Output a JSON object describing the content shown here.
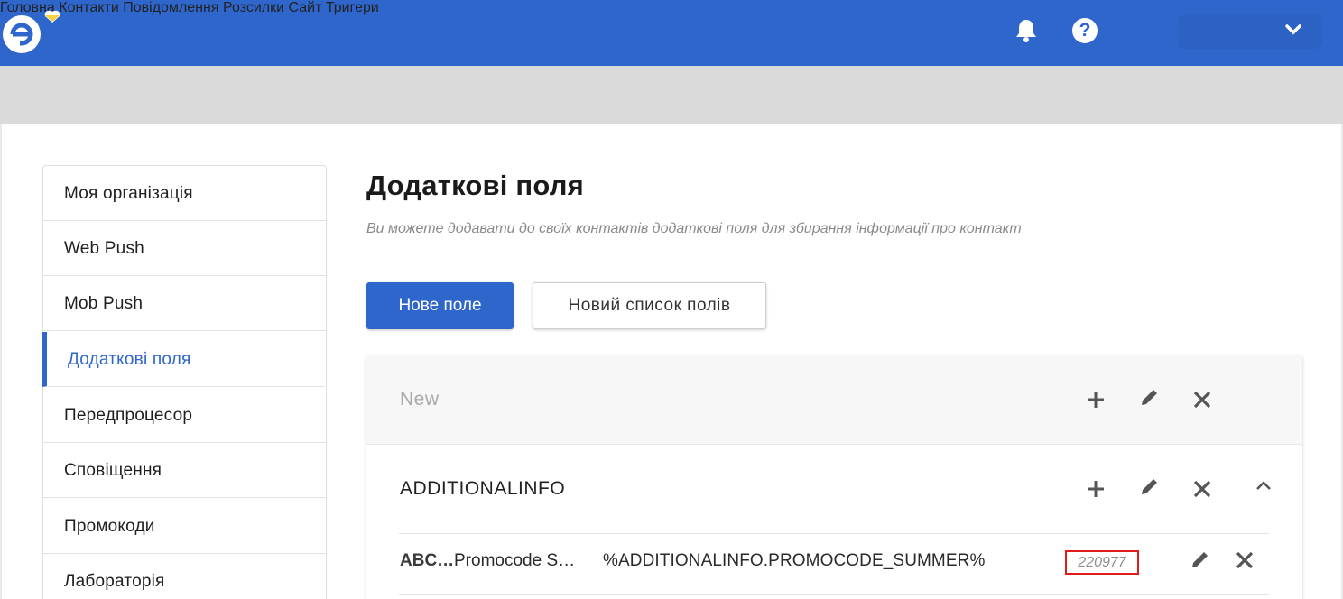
{
  "nav": {
    "items": [
      "Головна",
      "Контакти",
      "Повідомлення",
      "Розсилки",
      "Сайт",
      "Тригери"
    ]
  },
  "sidebar": {
    "items": [
      {
        "label": "Моя організація",
        "active": false
      },
      {
        "label": "Web Push",
        "active": false
      },
      {
        "label": "Mob Push",
        "active": false
      },
      {
        "label": "Додаткові поля",
        "active": true
      },
      {
        "label": "Передпроцесор",
        "active": false
      },
      {
        "label": "Сповіщення",
        "active": false
      },
      {
        "label": "Промокоди",
        "active": false
      },
      {
        "label": "Лабораторія",
        "active": false
      }
    ]
  },
  "main": {
    "title": "Додаткові поля",
    "subtitle": "Ви можете додавати до своїх контактів додаткові поля для збирання інформації про контакт",
    "new_field_button": "Нове поле",
    "new_list_button": "Новий список полів"
  },
  "lists": [
    {
      "name": "New",
      "muted": true
    },
    {
      "name": "ADDITIONALINFO",
      "fields": [
        {
          "type": "ABC…",
          "name": "Promocode S…",
          "variable": "%ADDITIONALINFO.PROMOCODE_SUMMER%",
          "id": "220977"
        }
      ]
    }
  ],
  "icons": {
    "logo": "esputnik-logo-icon",
    "bell": "bell-icon",
    "help": "help-icon",
    "account": "chevron-down-icon",
    "add": "plus-icon",
    "edit": "pencil-icon",
    "delete": "close-icon",
    "collapse": "chevron-up-icon"
  },
  "colors": {
    "brand": "#2e66cc",
    "highlight_box": "#e11a1a"
  }
}
